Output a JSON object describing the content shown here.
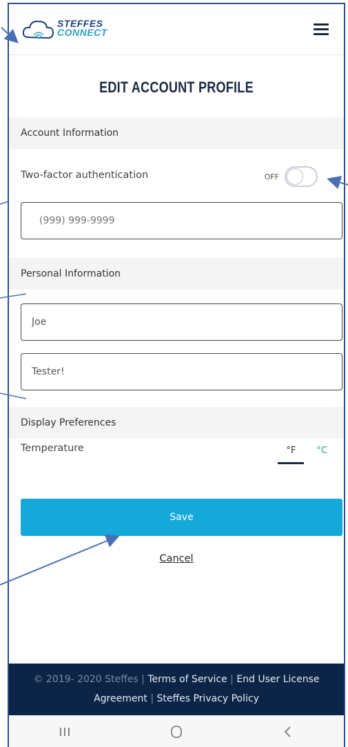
{
  "app": {
    "logo_line1": "STEFFES",
    "logo_line2": "CONNECT"
  },
  "page": {
    "title": "EDIT ACCOUNT PROFILE"
  },
  "account_information": {
    "heading": "Account Information",
    "two_factor_label": "Two-factor authentication",
    "two_factor_state": "OFF",
    "phone_placeholder": "(999) 999-9999"
  },
  "personal_information": {
    "heading": "Personal Information",
    "first_name_value": "Joe",
    "last_name_value": "Tester!"
  },
  "display_preferences": {
    "heading": "Display Preferences",
    "temperature_label": "Temperature",
    "unit_f": "°F",
    "unit_c": "°C",
    "selected_unit": "°F"
  },
  "actions": {
    "save_label": "Save",
    "cancel_label": "Cancel"
  },
  "footer": {
    "copyright": "© 2019- 2020 Steffes",
    "separator": "|",
    "terms": "Terms of Service",
    "eula_part1": "End User License",
    "eula_part2": "Agreement",
    "privacy": "Steffes Privacy Policy"
  },
  "colors": {
    "accent": "#14a9d9",
    "footer_bg": "#0c2446",
    "annotation": "#4a6fb5"
  },
  "icons": {
    "menu": "hamburger-menu-icon",
    "logo": "cloud-wifi-icon",
    "nav_recent": "recent-apps-icon",
    "nav_home": "home-icon",
    "nav_back": "back-icon"
  }
}
